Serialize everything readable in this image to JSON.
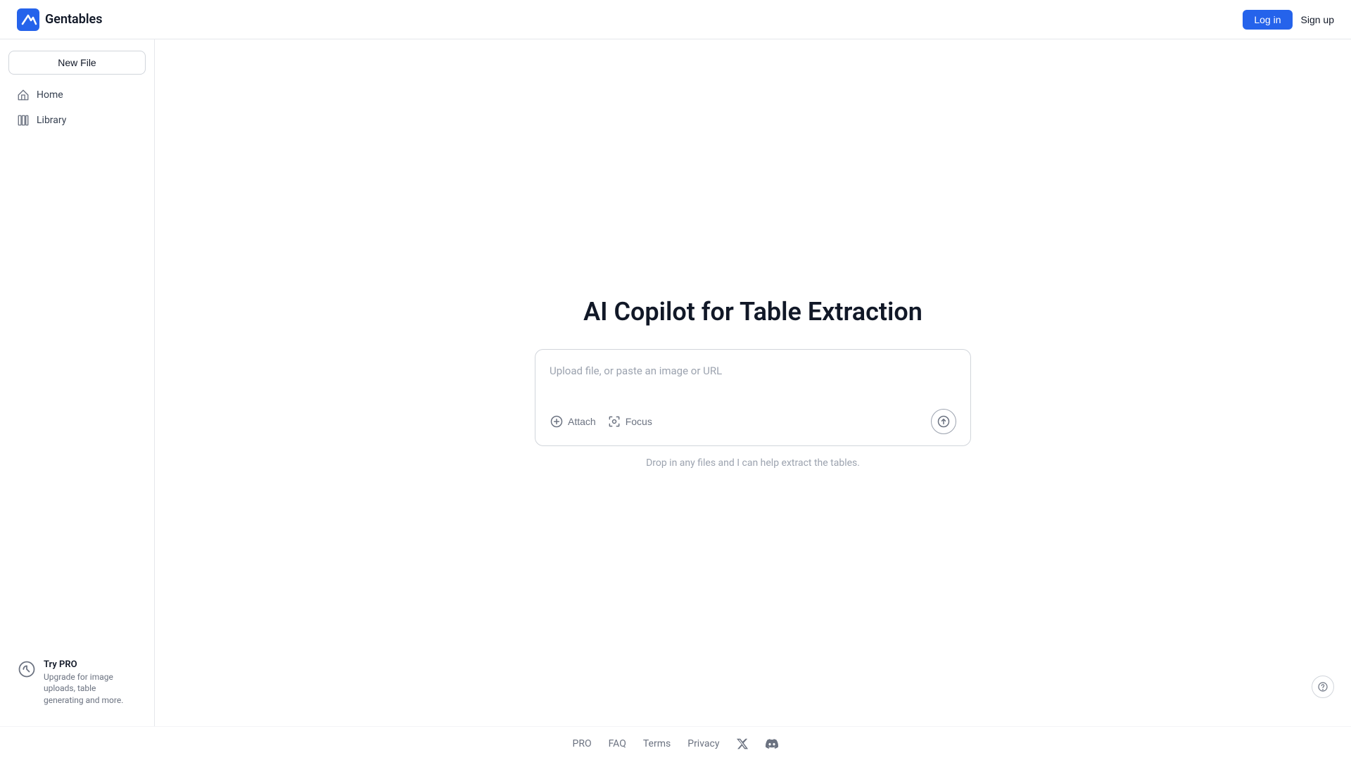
{
  "app": {
    "name": "Gentables",
    "title": "AI Copilot for Table Extraction"
  },
  "header": {
    "login_label": "Log in",
    "signup_label": "Sign up"
  },
  "sidebar": {
    "new_file_label": "New File",
    "nav_items": [
      {
        "id": "home",
        "label": "Home",
        "icon": "home-icon"
      },
      {
        "id": "library",
        "label": "Library",
        "icon": "library-icon"
      }
    ],
    "pro": {
      "title": "Try PRO",
      "description": "Upgrade for image uploads, table generating and more."
    }
  },
  "upload": {
    "placeholder": "Upload file, or paste an image or URL",
    "attach_label": "Attach",
    "focus_label": "Focus",
    "drop_hint": "Drop in any files and I can help extract the tables."
  },
  "footer": {
    "links": [
      {
        "id": "pro",
        "label": "PRO"
      },
      {
        "id": "faq",
        "label": "FAQ"
      },
      {
        "id": "terms",
        "label": "Terms"
      },
      {
        "id": "privacy",
        "label": "Privacy"
      }
    ]
  }
}
